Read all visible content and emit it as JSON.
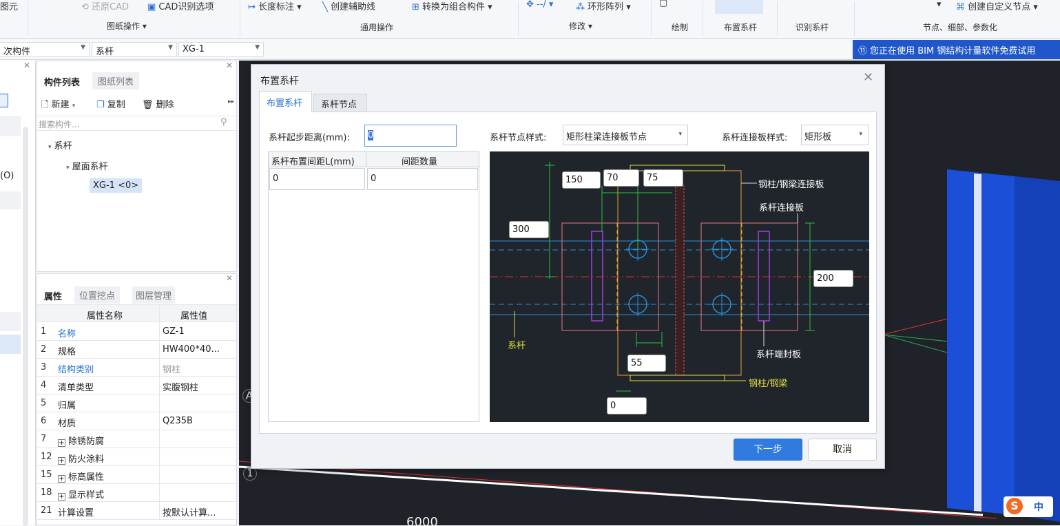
{
  "ribbon": {
    "left_cut": "图元",
    "restore_cad": "还原CAD",
    "cad_options": "CAD识别选项",
    "drawing_ops": "图纸操作 ▾",
    "dimension": "长度标注 ▾",
    "create_aux": "创建辅助线",
    "convert_group": "转换为组合构件 ▾",
    "ring_array": "环形阵列 ▾",
    "general_ops": "通用操作",
    "modify": "修改 ▾",
    "draw": "绘制",
    "place_tie": "布置系杆",
    "identify_tie": "识别系杆",
    "create_custom_node": "创建自定义节点 ▾",
    "nodes_group": "节点、细部、参数化"
  },
  "selectbar": {
    "sub_component": "次构件",
    "tie": "系杆",
    "xg1": "XG-1",
    "notice": "⑪ 您正在使用 BIM 钢结构计量软件免费试用"
  },
  "left": {
    "label_o": "(O)"
  },
  "component_panel": {
    "tab_list": "构件列表",
    "tab_drawings": "图纸列表",
    "new": "新建",
    "copy": "复制",
    "delete": "删除",
    "search_placeholder": "搜索构件...",
    "tree_root": "系杆",
    "tree_child": "屋面系杆",
    "tree_leaf": "XG-1 <0>"
  },
  "prop_panel": {
    "tab_props": "属性",
    "tab_position": "位置挖点",
    "tab_layers": "图层管理",
    "col_name": "属性名称",
    "col_value": "属性值",
    "rows": [
      {
        "n": "1",
        "k": "名称",
        "v": "GZ-1",
        "blue": true
      },
      {
        "n": "2",
        "k": "规格",
        "v": "HW400*40...",
        "blue": false
      },
      {
        "n": "3",
        "k": "结构类别",
        "v": "钢柱",
        "blue": true,
        "gray": true
      },
      {
        "n": "4",
        "k": "清单类型",
        "v": "实腹钢柱",
        "blue": false
      },
      {
        "n": "5",
        "k": "归属",
        "v": "",
        "blue": false
      },
      {
        "n": "6",
        "k": "材质",
        "v": "Q235B",
        "blue": false
      },
      {
        "n": "7",
        "k": "除锈防腐",
        "v": "",
        "plus": true
      },
      {
        "n": "12",
        "k": "防火涂料",
        "v": "",
        "plus": true
      },
      {
        "n": "15",
        "k": "标高属性",
        "v": "",
        "plus": true
      },
      {
        "n": "18",
        "k": "显示样式",
        "v": "",
        "plus": true
      },
      {
        "n": "21",
        "k": "计算设置",
        "v": "按默认计算...",
        "blue": false
      }
    ]
  },
  "viewport": {
    "label_a": "A",
    "label_1": "1",
    "label_6000": "6000",
    "ime": "中"
  },
  "dialog": {
    "title": "布置系杆",
    "tab_place": "布置系杆",
    "tab_node": "系杆节点",
    "start_label": "系杆起步距离(mm):",
    "start_value": "0",
    "col_spacing": "系杆布置间距L(mm)",
    "col_count": "间距数量",
    "row_spacing": "0",
    "row_count": "0",
    "node_style_label": "系杆节点样式:",
    "node_style_value": "矩形柱梁连接板节点",
    "plate_style_label": "系杆连接板样式:",
    "plate_style_value": "矩形板",
    "next": "下一步",
    "cancel": "取消"
  },
  "diagram": {
    "v150": "150",
    "v70": "70",
    "v75": "75",
    "v300": "300",
    "v200": "200",
    "v55": "55",
    "v0": "0",
    "lbl_colbeam_plate": "钢柱/钢梁连接板",
    "lbl_tie_plate": "系杆连接板",
    "lbl_tie": "系杆",
    "lbl_end_plate": "系杆端封板",
    "lbl_colbeam": "钢柱/钢梁"
  }
}
